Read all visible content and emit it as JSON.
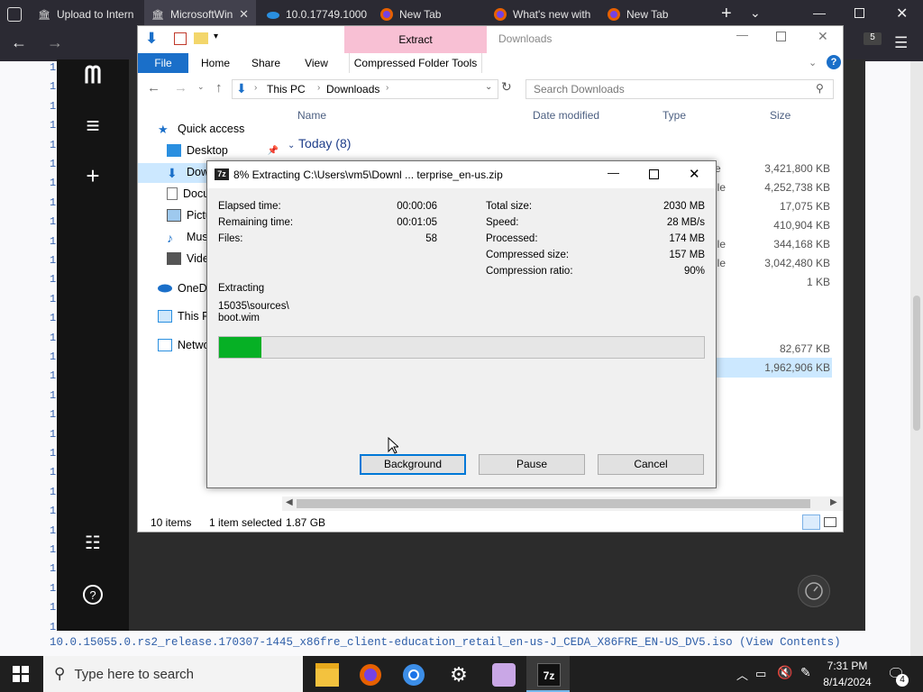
{
  "browser": {
    "tabs": [
      {
        "title": "Upload to Intern",
        "icon": "archive-icon"
      },
      {
        "title": "MicrosoftWin",
        "icon": "archive-icon",
        "active": true
      },
      {
        "title": "10.0.17749.1000",
        "icon": "cloud-icon"
      },
      {
        "title": "New Tab",
        "icon": "firefox-icon"
      },
      {
        "title": "What's new with",
        "icon": "firefox-icon"
      },
      {
        "title": "New Tab",
        "icon": "firefox-icon"
      }
    ],
    "badge": "5"
  },
  "page": {
    "line_prefix": "10",
    "iso_line": "10.0.15055.0.rs2_release.170307-1445_x86fre_client-education_retail_en-us-J_CEDA_X86FRE_EN-US_DV5.iso",
    "view_contents": "(View Contents)"
  },
  "explorer": {
    "title": "Downloads",
    "context_tab": "Extract",
    "context_subtab": "Compressed Folder Tools",
    "ribbon_tabs": [
      "File",
      "Home",
      "Share",
      "View"
    ],
    "breadcrumb": [
      "This PC",
      "Downloads"
    ],
    "search_placeholder": "Search Downloads",
    "columns": [
      "Name",
      "Date modified",
      "Type",
      "Size"
    ],
    "group": "Today (8)",
    "nav": {
      "quick_access": "Quick access",
      "items": [
        "Desktop",
        "Dow",
        "Docu",
        "Pictu",
        "Musi",
        "Vide",
        "OneDr",
        "This P",
        "Netwo"
      ]
    },
    "sizes": [
      "3,421,800 KB",
      "4,252,738 KB",
      "17,075 KB",
      "410,904 KB",
      "344,168 KB",
      "3,042,480 KB",
      "1 KB",
      "82,677 KB",
      "1,962,906 KB"
    ],
    "type_fragments": [
      "e",
      "ile",
      "ile",
      "ile"
    ],
    "status": {
      "count": "10 items",
      "selected": "1 item selected",
      "size": "1.87 GB"
    }
  },
  "zip": {
    "title": "8% Extracting C:\\Users\\vm5\\Downl ... terprise_en-us.zip",
    "left": [
      {
        "label": "Elapsed time:",
        "value": "00:00:06"
      },
      {
        "label": "Remaining time:",
        "value": "00:01:05"
      },
      {
        "label": "Files:",
        "value": "58"
      }
    ],
    "right": [
      {
        "label": "Total size:",
        "value": "2030 MB"
      },
      {
        "label": "Speed:",
        "value": "28 MB/s"
      },
      {
        "label": "Processed:",
        "value": "174 MB"
      },
      {
        "label": "Compressed size:",
        "value": "157 MB"
      },
      {
        "label": "Compression ratio:",
        "value": "90%"
      }
    ],
    "action": "Extracting",
    "path1": "15035\\sources\\",
    "path2": "boot.wim",
    "progress_percent": 8.7,
    "buttons": {
      "background": "Background",
      "pause": "Pause",
      "cancel": "Cancel"
    }
  },
  "taskbar": {
    "search_placeholder": "Type here to search",
    "time": "7:31 PM",
    "date": "8/14/2024",
    "notification_count": "4"
  },
  "colors": {
    "progress": "#06b025",
    "file_tab": "#1a6fc9",
    "extract_tab": "#f8c0d4",
    "link": "#2e5ea8"
  }
}
